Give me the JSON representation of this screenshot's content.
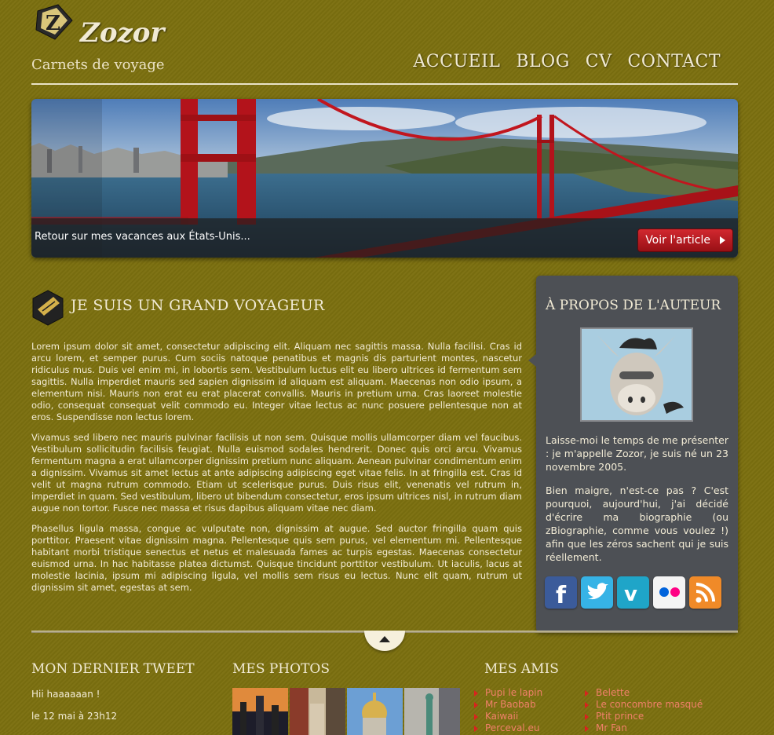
{
  "header": {
    "site_name": "Zozor",
    "tagline": "Carnets de voyage",
    "nav": [
      "ACCUEIL",
      "BLOG",
      "CV",
      "CONTACT"
    ]
  },
  "banner": {
    "caption": "Retour sur mes vacances aux États-Unis...",
    "button_label": "Voir l'article"
  },
  "main": {
    "title": "JE SUIS UN GRAND VOYAGEUR",
    "paragraphs": [
      "Lorem ipsum dolor sit amet, consectetur adipiscing elit. Aliquam nec sagittis massa. Nulla facilisi. Cras id arcu lorem, et semper purus. Cum sociis natoque penatibus et magnis dis parturient montes, nascetur ridiculus mus. Duis vel enim mi, in lobortis sem. Vestibulum luctus elit eu libero ultrices id fermentum sem sagittis. Nulla imperdiet mauris sed sapien dignissim id aliquam est aliquam. Maecenas non odio ipsum, a elementum nisi. Mauris non erat eu erat placerat convallis. Mauris in pretium urna. Cras laoreet molestie odio, consequat consequat velit commodo eu. Integer vitae lectus ac nunc posuere pellentesque non at eros. Suspendisse non lectus lorem.",
      "Vivamus sed libero nec mauris pulvinar facilisis ut non sem. Quisque mollis ullamcorper diam vel faucibus. Vestibulum sollicitudin facilisis feugiat. Nulla euismod sodales hendrerit. Donec quis orci arcu. Vivamus fermentum magna a erat ullamcorper dignissim pretium nunc aliquam. Aenean pulvinar condimentum enim a dignissim. Vivamus sit amet lectus at ante adipiscing adipiscing eget vitae felis. In at fringilla est. Cras id velit ut magna rutrum commodo. Etiam ut scelerisque purus. Duis risus elit, venenatis vel rutrum in, imperdiet in quam. Sed vestibulum, libero ut bibendum consectetur, eros ipsum ultrices nisl, in rutrum diam augue non tortor. Fusce nec massa et risus dapibus aliquam vitae nec diam.",
      "Phasellus ligula massa, congue ac vulputate non, dignissim at augue. Sed auctor fringilla quam quis porttitor. Praesent vitae dignissim magna. Pellentesque quis sem purus, vel elementum mi. Pellentesque habitant morbi tristique senectus et netus et malesuada fames ac turpis egestas. Maecenas consectetur euismod urna. In hac habitasse platea dictumst. Quisque tincidunt porttitor vestibulum. Ut iaculis, lacus at molestie lacinia, ipsum mi adipiscing ligula, vel mollis sem risus eu lectus. Nunc elit quam, rutrum ut dignissim sit amet, egestas at sem."
    ]
  },
  "aside": {
    "title": "À PROPOS DE L'AUTEUR",
    "paragraphs": [
      "Laisse-moi le temps de me présenter : je m'appelle Zozor, je suis né un 23 novembre 2005.",
      "Bien maigre, n'est-ce pas ? C'est pourquoi, aujourd'hui, j'ai décidé d'écrire ma biographie (ou zBiographie, comme vous voulez !) afin que les zéros sachent qui je suis réellement."
    ],
    "socials": [
      "facebook-icon",
      "twitter-icon",
      "vimeo-icon",
      "flickr-icon",
      "rss-icon"
    ]
  },
  "footer": {
    "tweet_title": "MON DERNIER TWEET",
    "tweet_text": "Hii haaaaaan !",
    "tweet_date": "le 12 mai à 23h12",
    "photos_title": "MES PHOTOS",
    "friends_title": "MES AMIS",
    "friends_col1": [
      "Pupi le lapin",
      "Mr Baobab",
      "Kaiwaii",
      "Perceval.eu"
    ],
    "friends_col2": [
      "Belette",
      "Le concombre masqué",
      "Ptit prince",
      "Mr Fan"
    ]
  },
  "colors": {
    "background": "#7c7010",
    "aside_bg": "#4d5055",
    "button_red": "#c0141c",
    "link_salmon": "#f0806a"
  }
}
